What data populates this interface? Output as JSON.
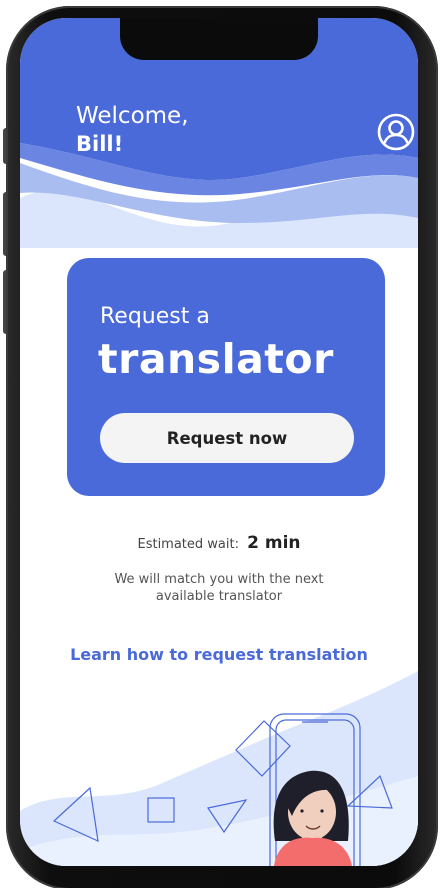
{
  "header": {
    "greeting": "Welcome,",
    "user_name": "Bill!"
  },
  "card": {
    "subtitle": "Request a",
    "title": "translator",
    "button_label": "Request now"
  },
  "wait": {
    "label": "Estimated wait:",
    "value": "2 min"
  },
  "info_text": "We will match you with the next available translator",
  "learn_link": "Learn how to request translation",
  "colors": {
    "brand_blue": "#4a6ad9",
    "wave_light": "#dbe6fd",
    "button_bg": "#f4f4f4"
  },
  "icons": {
    "profile": "user-circle-icon"
  }
}
